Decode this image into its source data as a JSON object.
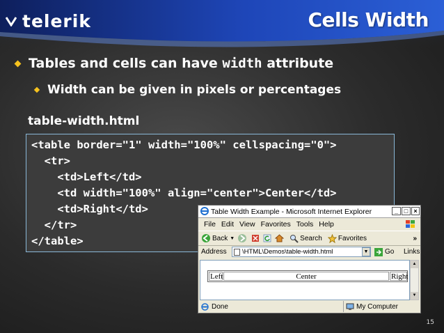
{
  "header": {
    "logo_text": "telerik",
    "title": "Cells Width"
  },
  "bullets": {
    "level1_prefix": "Tables and cells can have ",
    "level1_code": "width",
    "level1_suffix": " attribute",
    "level2": "Width can be given in pixels or percentages"
  },
  "filename": "table-width.html",
  "code": {
    "lines": [
      "<table border=\"1\" width=\"100%\" cellspacing=\"0\">",
      "  <tr>",
      "    <td>Left</td>",
      "    <td width=\"100%\" align=\"center\">Center</td>",
      "    <td>Right</td>",
      "  </tr>",
      "</table>"
    ]
  },
  "browser": {
    "title": "Table Width Example - Microsoft Internet Explorer",
    "menu": [
      "File",
      "Edit",
      "View",
      "Favorites",
      "Tools",
      "Help"
    ],
    "toolbar": {
      "back": "Back",
      "search": "Search",
      "favorites": "Favorites"
    },
    "address_label": "Address",
    "address_value": "\\HTML\\Demos\\table-width.html",
    "go_label": "Go",
    "links_label": "Links",
    "cells": [
      "Left",
      "Center",
      "Right"
    ],
    "status_left": "Done",
    "status_right": "My Computer"
  },
  "page_number": "15",
  "colors": {
    "accent_bullet": "#f6c21e",
    "header_blue": "#1a3fa8",
    "code_border": "#8ab8d8"
  }
}
